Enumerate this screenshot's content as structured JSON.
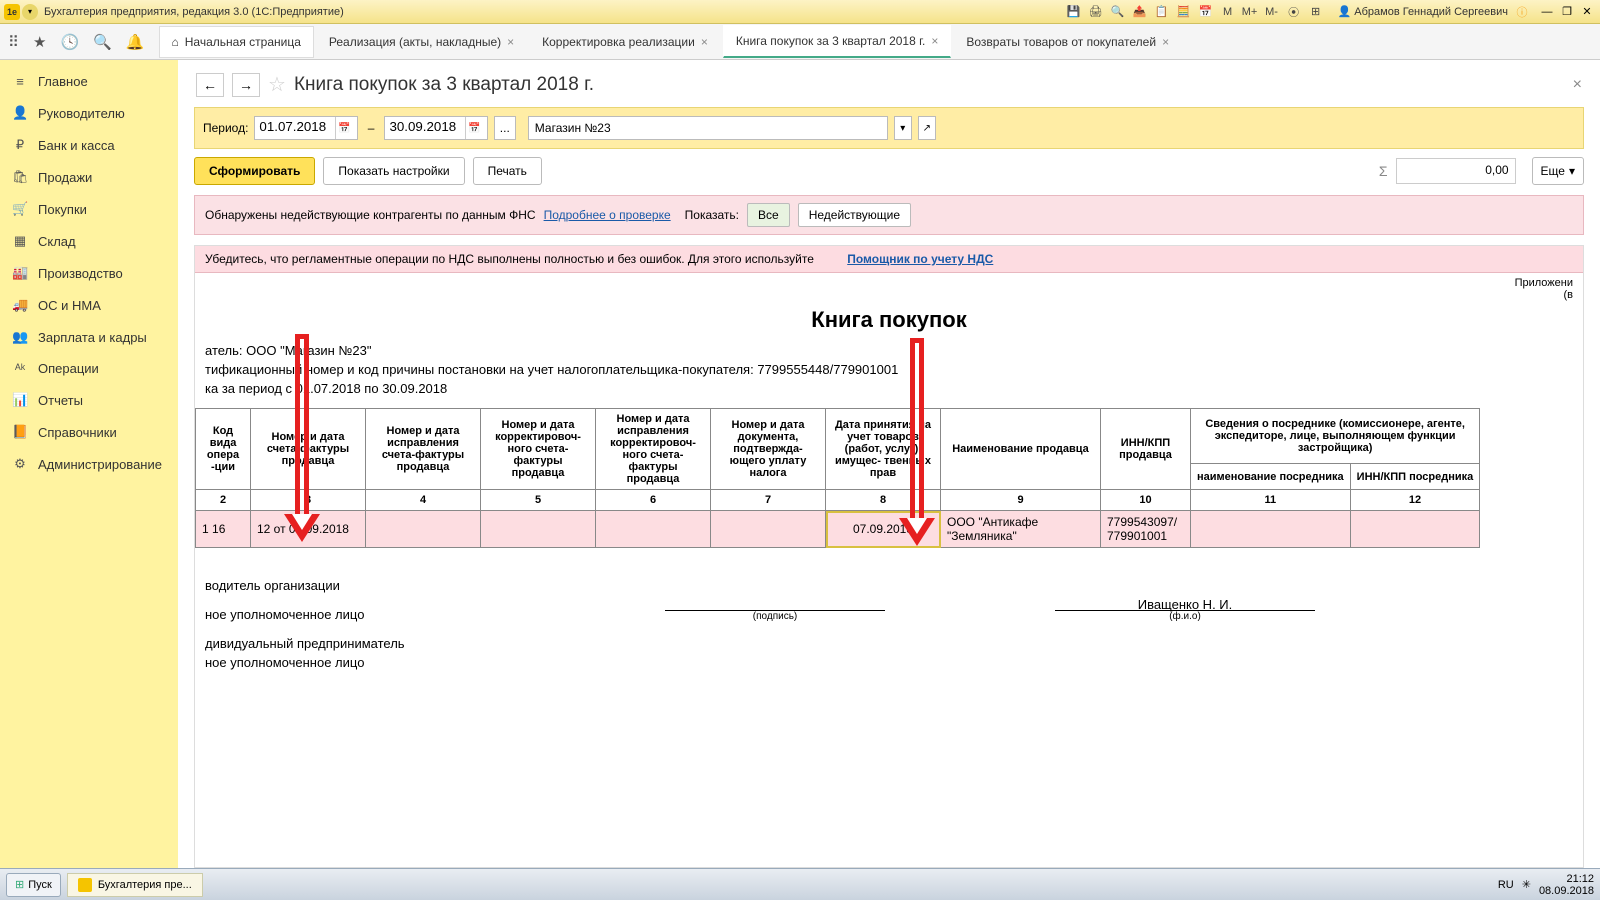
{
  "titlebar": {
    "title": "Бухгалтерия предприятия, редакция 3.0  (1С:Предприятие)",
    "user": "Абрамов Геннадий Сергеевич",
    "mem": [
      "M",
      "M+",
      "M-"
    ]
  },
  "tabs": {
    "home": "Начальная страница",
    "items": [
      {
        "label": "Реализация (акты, накладные)"
      },
      {
        "label": "Корректировка реализации"
      },
      {
        "label": "Книга покупок за 3 квартал 2018 г.",
        "active": true
      },
      {
        "label": "Возвраты товаров от покупателей"
      }
    ]
  },
  "sidebar": [
    {
      "icon": "≡",
      "label": "Главное"
    },
    {
      "icon": "👤",
      "label": "Руководителю"
    },
    {
      "icon": "₽",
      "label": "Банк и касса"
    },
    {
      "icon": "🛍",
      "label": "Продажи"
    },
    {
      "icon": "🛒",
      "label": "Покупки"
    },
    {
      "icon": "▦",
      "label": "Склад"
    },
    {
      "icon": "🏭",
      "label": "Производство"
    },
    {
      "icon": "🚚",
      "label": "ОС и НМА"
    },
    {
      "icon": "👥",
      "label": "Зарплата и кадры"
    },
    {
      "icon": "ᴬᵏ",
      "label": "Операции"
    },
    {
      "icon": "📊",
      "label": "Отчеты"
    },
    {
      "icon": "📙",
      "label": "Справочники"
    },
    {
      "icon": "⚙",
      "label": "Администрирование"
    }
  ],
  "header": {
    "title": "Книга покупок за 3 квартал 2018 г."
  },
  "toolbar": {
    "period_label": "Период:",
    "date_from": "01.07.2018",
    "date_to": "30.09.2018",
    "org": "Магазин №23"
  },
  "actions": {
    "form": "Сформировать",
    "settings": "Показать настройки",
    "print": "Печать",
    "sum_val": "0,00",
    "more": "Еще"
  },
  "warn": {
    "text": "Обнаружены недействующие контрагенты по данным ФНС",
    "link": "Подробнее о проверке",
    "show": "Показать:",
    "all": "Все",
    "invalid": "Недействующие"
  },
  "notice": {
    "text": "Убедитесь, что регламентные операции по НДС выполнены полностью и без ошибок. Для этого используйте",
    "link": "Помощник по учету НДС"
  },
  "report": {
    "appendix": "Приложени",
    "appendix2": "(в",
    "title": "Книга покупок",
    "buyer": "атель:  ООО \"Магазин №23\"",
    "inn": "тификационный номер и код причины постановки на учет налогоплательщика-покупателя:  7799555448/779901001",
    "period": "ка за период с 01.07.2018 по 30.09.2018",
    "headers": {
      "c2": "Код вида опера -ции",
      "c3": "Номер и дата счета-фактуры продавца",
      "c4": "Номер и дата исправления счета-фактуры продавца",
      "c5": "Номер и дата корректировоч- ного счета-фактуры продавца",
      "c6": "Номер и дата исправления корректировоч- ного счета-фактуры продавца",
      "c7": "Номер и дата документа, подтвержда- ющего уплату налога",
      "c8": "Дата принятия на учет товаров (работ, услуг), имущес- твенных прав",
      "c9": "Наименование продавца",
      "c10": "ИНН/КПП продавца",
      "c11_top": "Сведения о посреднике (комиссионере, агенте, экспедиторе, лице, выполняющем функции застройщика)",
      "c11": "наименование посредника",
      "c12": "ИНН/КПП посредника"
    },
    "nums": [
      "2",
      "3",
      "4",
      "5",
      "6",
      "7",
      "8",
      "9",
      "10",
      "11",
      "12"
    ],
    "row": {
      "n": "1",
      "c2": "16",
      "c3": "12 от 07.09.2018",
      "c4": "",
      "c5": "",
      "c6": "",
      "c7": "",
      "c8": "07.09.2018",
      "c9": "ООО \"Антикафе \"Земляника\"",
      "c10": "7799543097/ 779901001",
      "c11": "",
      "c12": ""
    },
    "sig": {
      "head": "водитель организации",
      "auth": "ное уполномоченное лицо",
      "ip": "дивидуальный предприниматель",
      "auth2": "ное уполномоченное лицо",
      "podpis": "(подпись)",
      "fio_label": "(ф.и.о)",
      "fio": "Иващенко Н. И."
    }
  },
  "taskbar": {
    "start": "Пуск",
    "task": "Бухгалтерия пре...",
    "lang": "RU",
    "time": "21:12",
    "date": "08.09.2018"
  }
}
